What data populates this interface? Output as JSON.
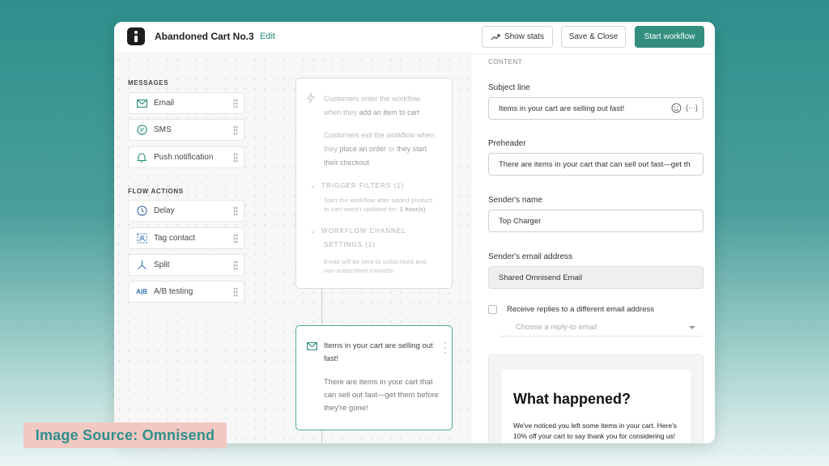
{
  "header": {
    "title": "Abandoned Cart No.3",
    "edit_label": "Edit",
    "show_stats_label": "Show stats",
    "save_close_label": "Save & Close",
    "start_workflow_label": "Start workflow"
  },
  "sidebar": {
    "messages_title": "MESSAGES",
    "messages": [
      {
        "label": "Email",
        "icon": "envelope-icon"
      },
      {
        "label": "SMS",
        "icon": "sms-icon"
      },
      {
        "label": "Push notification",
        "icon": "bell-icon"
      }
    ],
    "flow_actions_title": "FLOW ACTIONS",
    "flow_actions": [
      {
        "label": "Delay",
        "icon": "clock-icon"
      },
      {
        "label": "Tag contact",
        "icon": "tag-icon"
      },
      {
        "label": "Split",
        "icon": "split-icon"
      },
      {
        "label": "A/B testing",
        "icon": "ab-icon"
      }
    ]
  },
  "trigger_node": {
    "enter_a": "Customers enter the workflow",
    "enter_b": "when they ",
    "enter_strong": "add an item to cart",
    "exit_a": "Customers exit the workflow when",
    "exit_b1": "they ",
    "exit_b_strong1": "place an order",
    "exit_b2": " or ",
    "exit_b_strong2": "they start",
    "exit_c_strong": "their checkout",
    "trigger_filters": "TRIGGER FILTERS (1)",
    "trigger_filters_desc_1": "Start the workflow after added product",
    "trigger_filters_desc_2a": "to cart wasn't updated for: ",
    "trigger_filters_desc_2b": "1 hour(s)",
    "channel_settings_1": "WORKFLOW CHANNEL",
    "channel_settings_2": "SETTINGS (1)",
    "channel_desc_1": "Email will be sent to subscribed and",
    "channel_desc_2": "non-subscribed contacts"
  },
  "email_node": {
    "title_1": "Items in your cart are selling out",
    "title_2": "fast!",
    "body_1": "There are items in your cart that",
    "body_2": "can sell out fast—get them before",
    "body_3": "they're gone!"
  },
  "panel": {
    "content_title": "CONTENT",
    "subject_label": "Subject line",
    "subject_value": "Items in your cart are selling out fast!",
    "preheader_label": "Preheader",
    "preheader_value": "There are items in your cart that can sell out fast—get th",
    "sender_name_label": "Sender's name",
    "sender_name_value": "Top Charger",
    "sender_email_label": "Sender's email address",
    "sender_email_value": "Shared Omnisend Email",
    "reply_checkbox_label": "Receive replies to a different email address",
    "reply_select_placeholder": "Choose a reply-to email",
    "preview_title": "What happened?",
    "preview_body": "We've noticed you left some items in your cart. Here's 10% off your cart to say thank you for considering us!"
  },
  "source_label": "Image Source: Omnisend",
  "colors": {
    "accent": "#338e80",
    "background_teal": "#2e8f8c",
    "source_badge": "#f2c8c2"
  }
}
